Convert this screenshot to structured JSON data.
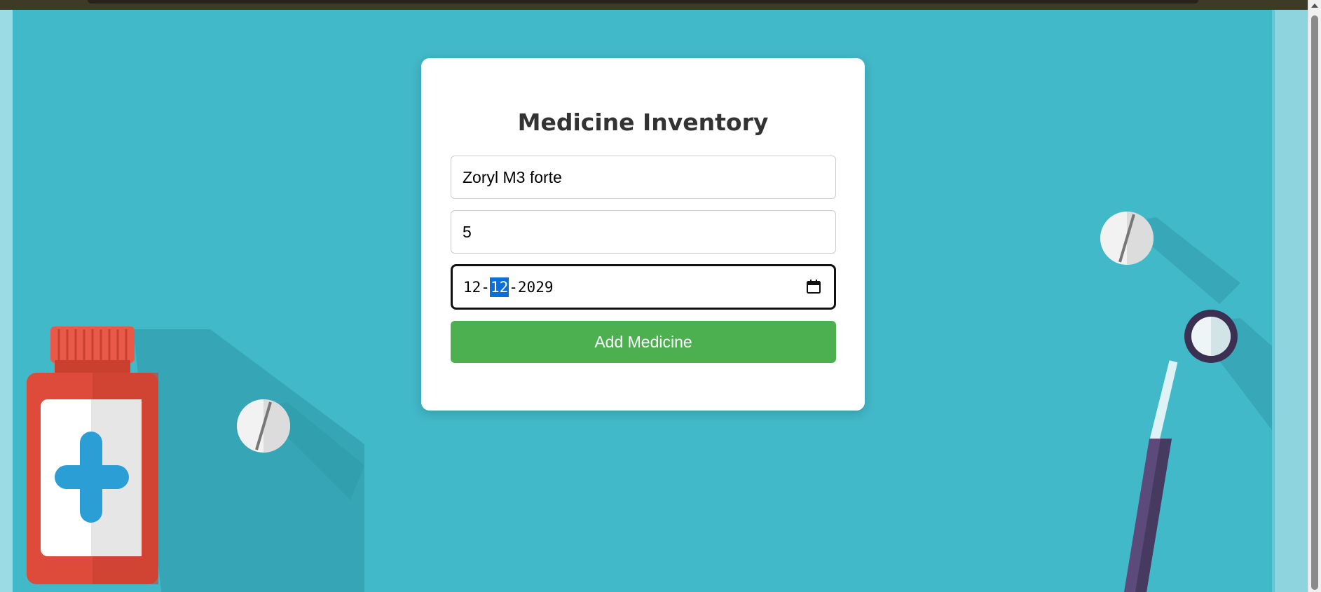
{
  "form": {
    "title": "Medicine Inventory",
    "name_value": "Zoryl M3 forte",
    "quantity_value": "5",
    "expiry_date": {
      "day": "12",
      "month": "12",
      "year": "2029",
      "separator": "-",
      "selected_segment": "month"
    },
    "submit_label": "Add Medicine"
  },
  "colors": {
    "background": "#42b9c9",
    "submit_button": "#4caf50",
    "selection_highlight": "#0a6fd6"
  },
  "icons": [
    "calendar-icon",
    "medicine-bottle-illustration",
    "pill-illustration",
    "dental-mirror-illustration"
  ]
}
